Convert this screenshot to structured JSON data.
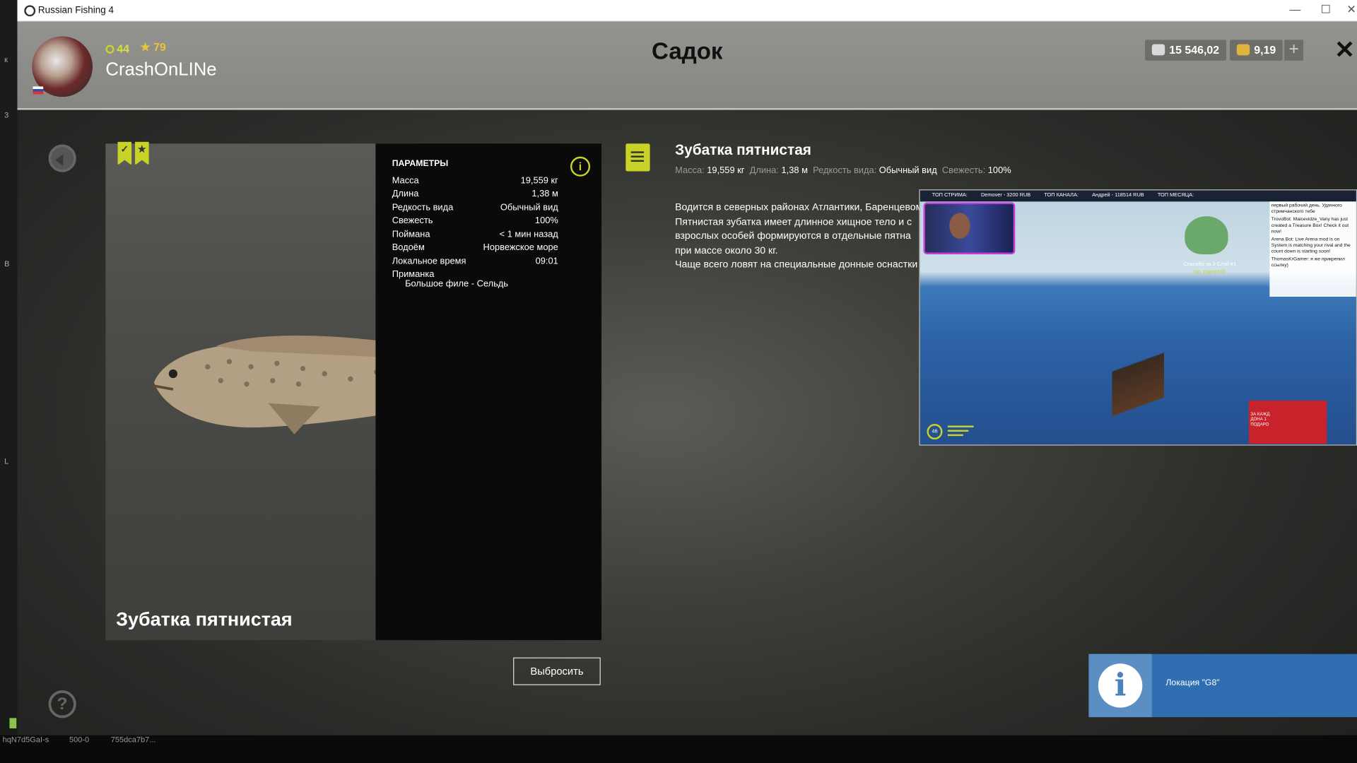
{
  "window": {
    "title": "Russian Fishing 4"
  },
  "header": {
    "level": "44",
    "rank": "79",
    "username": "CrashOnLINe",
    "screen_title": "Садок",
    "silver": "15 546,02",
    "gold": "9,19"
  },
  "fish": {
    "name": "Зубатка пятнистая",
    "params_title": "ПАРАМЕТРЫ",
    "params": [
      {
        "label": "Масса",
        "value": "19,559 кг"
      },
      {
        "label": "Длина",
        "value": "1,38 м"
      },
      {
        "label": "Редкость вида",
        "value": "Обычный вид"
      },
      {
        "label": "Свежесть",
        "value": "100%"
      },
      {
        "label": "Поймана",
        "value": "< 1 мин назад"
      },
      {
        "label": "Водоём",
        "value": "Норвежское море"
      },
      {
        "label": "Локальное время",
        "value": "09:01"
      }
    ],
    "bait_label": "Приманка",
    "bait_value": "Большое филе - Сельдь",
    "discard_button": "Выбросить"
  },
  "description": {
    "title": "Зубатка пятнистая",
    "meta": [
      {
        "label": "Масса:",
        "value": "19,559 кг"
      },
      {
        "label": "Длина:",
        "value": "1,38 м"
      },
      {
        "label": "Редкость вида:",
        "value": "Обычный вид"
      },
      {
        "label": "Свежесть:",
        "value": "100%"
      }
    ],
    "lines": [
      "Водится в северных районах Атлантики, Баренцевом",
      "Пятнистая зубатка имеет длинное хищное тело и с",
      "взрослых особей формируются в отдельные пятна",
      "при массе около 30 кг.",
      "Чаще всего ловят на специальные донные оснастки"
    ]
  },
  "stream": {
    "topbar": [
      "ТОП СТРИМА:",
      "Demover - 3200 RUB",
      "ТОП КАНАЛА:",
      "Андрей - 118514 RUB",
      "ТОП МЕСЯЦА:"
    ],
    "chat": [
      "первый рабочий день. Удачного стримчанского тебе",
      "TrovoBot: Maicevidze_Vany has just created a Treasure Box! Check it out now!",
      "Arena Bot: Live Arena mod is on System is matching your rival and the count down is starting soon!",
      "ThomasKrGamer: я же прикрепил ссылку)"
    ],
    "donate_text": "Спасибо за 3 Слэй #1",
    "donor": "No_Name555",
    "hud_level": "46",
    "promo": "ЗА КАЖД. ДОНА 1 ПОДАРО"
  },
  "notification": {
    "text": "Локация \"G8\""
  },
  "debug": {
    "items": [
      "hqN7d5GaI-s",
      "500-0",
      "755dca7b7..."
    ]
  },
  "desktop_strip": [
    "к",
    "3",
    "В",
    "L"
  ],
  "colors": {
    "accent": "#c9d226",
    "notification": "#2f6fb1",
    "header_bg": "#8d8d89"
  },
  "icons": {
    "back": "back-arrow-icon",
    "help": "question-icon",
    "info": "info-icon",
    "doc": "document-icon",
    "close": "close-icon",
    "plus": "plus-icon",
    "silver": "silver-coins-icon",
    "gold": "gold-coins-icon"
  }
}
